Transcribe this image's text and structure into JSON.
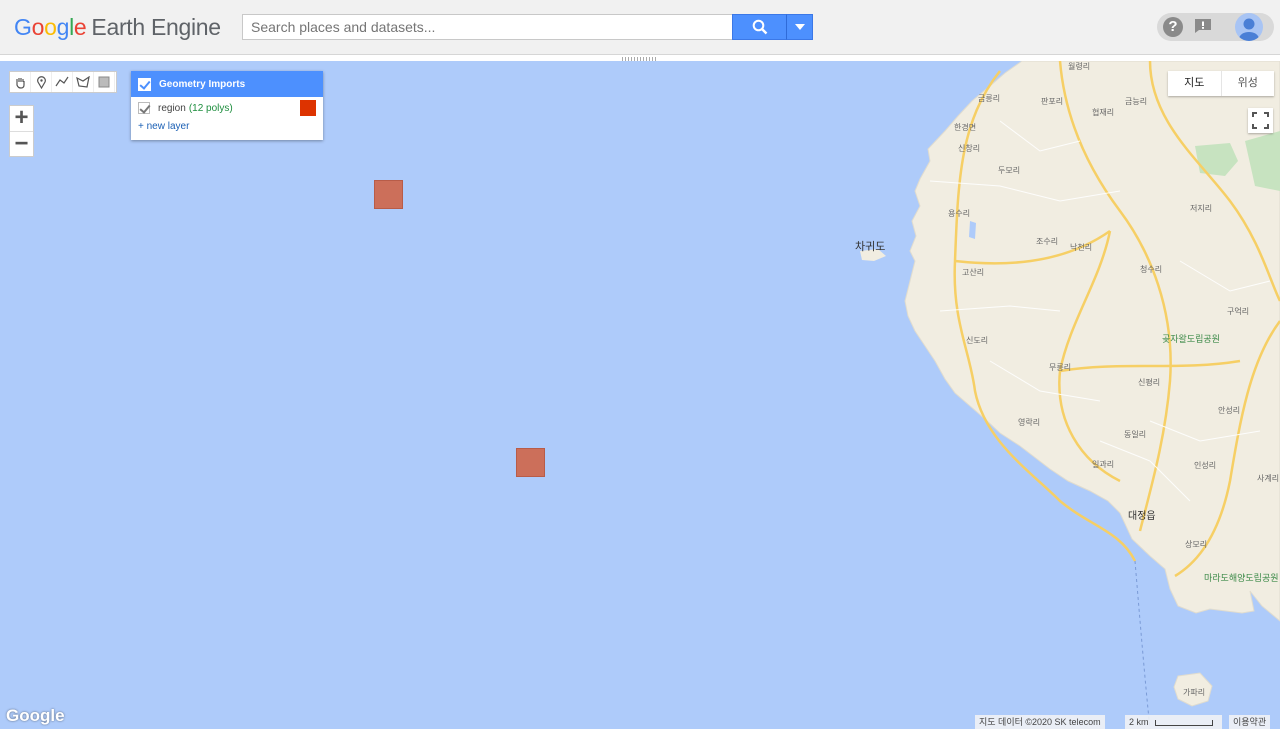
{
  "header": {
    "logo_google": [
      "G",
      "o",
      "o",
      "g",
      "l",
      "e"
    ],
    "logo_product": "Earth Engine",
    "search_placeholder": "Search places and datasets...",
    "icons": [
      "search-icon",
      "dropdown-icon",
      "help-icon",
      "feedback-icon",
      "avatar"
    ]
  },
  "map_tools": {
    "draw_icons": [
      "hand-icon",
      "marker-icon",
      "line-icon",
      "polygon-icon",
      "rectangle-icon"
    ],
    "zoom_in": "+",
    "zoom_out": "−"
  },
  "geometry_imports": {
    "title": "Geometry Imports",
    "layers": [
      {
        "name": "region",
        "count": "(12 polys)",
        "color": "#dd3300"
      }
    ],
    "new_layer": "+ new layer"
  },
  "map_type": {
    "map": "지도",
    "satellite": "위성"
  },
  "places": [
    "월령리",
    "금릉리",
    "판포리",
    "금능리",
    "협재리",
    "한경면",
    "신창리",
    "두모리",
    "용수리",
    "저지리",
    "차귀도",
    "조수리",
    "낙천리",
    "고산리",
    "청수리",
    "구억리",
    "곶자왈도립공원",
    "신도리",
    "무릉리",
    "신평리",
    "안성리",
    "영락리",
    "일과리",
    "동일리",
    "인성리",
    "사계리",
    "대정읍",
    "상모리",
    "마라도해양도립공원",
    "가파리"
  ],
  "footer": {
    "watermark": "Google",
    "attribution": "지도 데이터 ©2020 SK telecom",
    "scale": "2 km",
    "terms": "이용약관"
  }
}
